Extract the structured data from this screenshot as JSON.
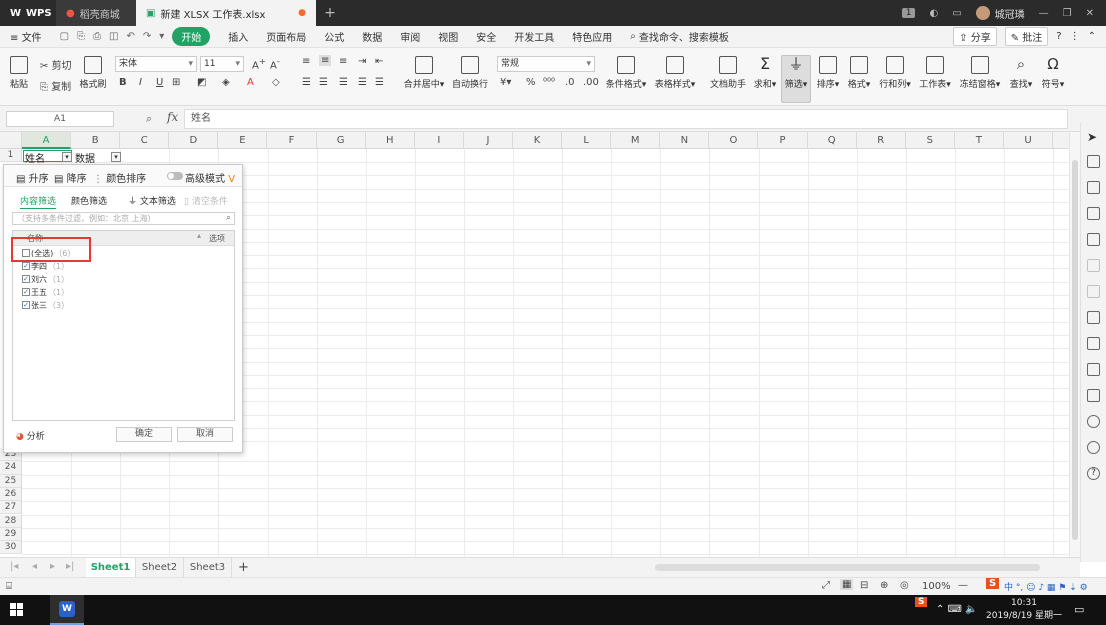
{
  "titlebar": {
    "app_tab": "WPS",
    "store_tab": "稻壳商城",
    "doc_tab": "新建 XLSX 工作表.xlsx",
    "badge": "1",
    "user": "城冠璘"
  },
  "menu": {
    "file": "文件",
    "items": [
      "开始",
      "插入",
      "页面布局",
      "公式",
      "数据",
      "审阅",
      "视图",
      "安全",
      "开发工具",
      "特色应用"
    ],
    "search": "查找命令、搜索模板",
    "share": "分享",
    "comment": "批注"
  },
  "ribbon": {
    "paste": "粘贴",
    "cut": "剪切",
    "copy": "复制",
    "format_painter": "格式刷",
    "font_name": "宋体",
    "font_size": "11",
    "merge": "合并居中",
    "wrap": "自动换行",
    "number_format": "常规",
    "cond_format": "条件格式",
    "table_style": "表格样式",
    "doc_helper": "文档助手",
    "sum": "求和",
    "filter": "筛选",
    "sort": "排序",
    "format": "格式",
    "row_col": "行和列",
    "worksheet": "工作表",
    "freeze": "冻结窗格",
    "find": "查找",
    "symbol": "符号"
  },
  "formula": {
    "namebox": "A1",
    "fx": "fx",
    "content": "姓名"
  },
  "grid": {
    "columns": [
      "A",
      "B",
      "C",
      "D",
      "E",
      "F",
      "G",
      "H",
      "I",
      "J",
      "K",
      "L",
      "M",
      "N",
      "O",
      "P",
      "Q",
      "R",
      "S",
      "T",
      "U"
    ],
    "rows_top": [
      "1"
    ],
    "rows_bottom": [
      "23",
      "24",
      "25",
      "26",
      "27",
      "28",
      "29",
      "30"
    ],
    "a1": "姓名",
    "b1": "数据"
  },
  "popup": {
    "asc": "升序",
    "desc": "降序",
    "color_sort": "颜色排序",
    "advanced": "高级模式",
    "tab_content": "内容筛选",
    "tab_color": "颜色筛选",
    "text_filter": "文本筛选",
    "clear": "清空条件",
    "search_placeholder": "（支持多条件过滤，例如：北京 上海）",
    "list_head": "名称",
    "list_options": "选项",
    "items": [
      {
        "label": "(全选)",
        "count": "（6）"
      },
      {
        "label": "李四",
        "count": "（1）"
      },
      {
        "label": "刘六",
        "count": "（1）"
      },
      {
        "label": "王五",
        "count": "（1）"
      },
      {
        "label": "张三",
        "count": "（3）"
      }
    ],
    "analyze": "分析",
    "ok": "确定",
    "cancel": "取消"
  },
  "sheets": [
    "Sheet1",
    "Sheet2",
    "Sheet3"
  ],
  "status": {
    "zoom": "100%"
  },
  "taskbar": {
    "time": "10:31",
    "date": "2019/8/19 星期一"
  },
  "colors": {
    "accent": "#21a366",
    "highlight": "#e53935"
  }
}
